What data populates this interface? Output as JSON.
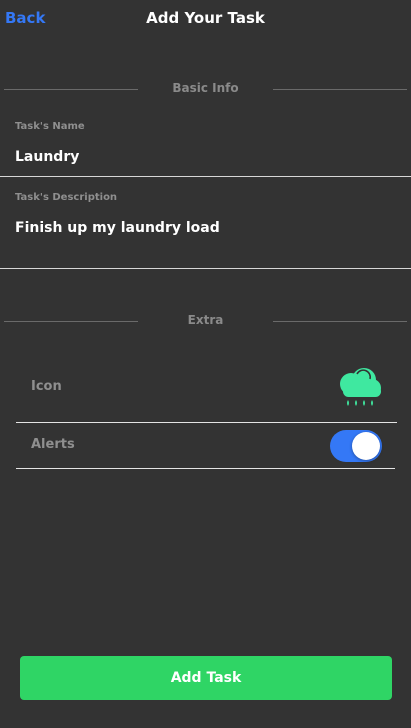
{
  "header": {
    "back_label": "Back",
    "title": "Add Your Task"
  },
  "sections": {
    "basic_info": "Basic Info",
    "extra": "Extra"
  },
  "fields": {
    "name_label": "Task's Name",
    "name_value": "Laundry",
    "description_label": "Task's Description",
    "description_value": "Finish up my laundry load"
  },
  "extra": {
    "icon_label": "Icon",
    "icon_name": "cloud-rain-icon",
    "alerts_label": "Alerts",
    "alerts_on": true
  },
  "footer": {
    "add_label": "Add Task"
  },
  "colors": {
    "background": "#333333",
    "accent_blue": "#3478F6",
    "accent_green": "#2FD565",
    "icon_green": "#3FE8A0"
  }
}
